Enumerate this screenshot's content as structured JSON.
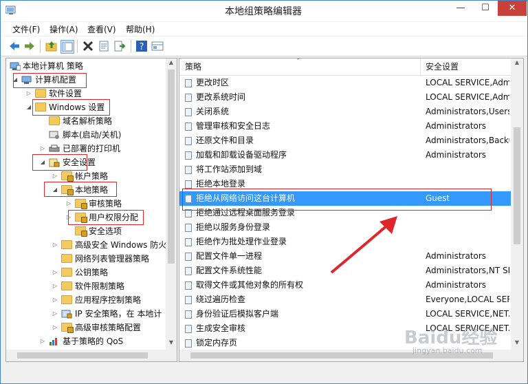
{
  "window": {
    "title": "本地组策略编辑器",
    "min_glyph": "—",
    "max_glyph": "☐",
    "close_glyph": "✕"
  },
  "menu": [
    {
      "label": "文件(F)"
    },
    {
      "label": "操作(A)"
    },
    {
      "label": "查看(V)"
    },
    {
      "label": "帮助(H)"
    }
  ],
  "toolbar": [
    "back-icon",
    "forward-icon",
    "up-folder-icon",
    "show-hide-tree-icon",
    "delete-icon",
    "properties-icon",
    "export-icon",
    "help-icon",
    "filter-icon"
  ],
  "tree": [
    {
      "label": "本地计算机 策略",
      "arrow": "",
      "icon": "computer-policy"
    },
    {
      "label": "计算机配置",
      "arrow": "◢",
      "icon": "computer"
    },
    {
      "label": "软件设置",
      "arrow": "▷",
      "icon": "folder"
    },
    {
      "label": "Windows 设置",
      "arrow": "◢",
      "icon": "folder"
    },
    {
      "label": "域名解析策略",
      "arrow": "",
      "icon": "folder"
    },
    {
      "label": "脚本(启动/关机)",
      "arrow": "",
      "icon": "script"
    },
    {
      "label": "已部署的打印机",
      "arrow": "▷",
      "icon": "printer"
    },
    {
      "label": "安全设置",
      "arrow": "◢",
      "icon": "security"
    },
    {
      "label": "帐户策略",
      "arrow": "▷",
      "icon": "folder-lock"
    },
    {
      "label": "本地策略",
      "arrow": "◢",
      "icon": "folder-lock"
    },
    {
      "label": "审核策略",
      "arrow": "▷",
      "icon": "folder-lock"
    },
    {
      "label": "用户权限分配",
      "arrow": "▷",
      "icon": "folder-lock"
    },
    {
      "label": "安全选项",
      "arrow": "",
      "icon": "folder-lock"
    },
    {
      "label": "高级安全 Windows 防火",
      "arrow": "▷",
      "icon": "folder"
    },
    {
      "label": "网络列表管理器策略",
      "arrow": "",
      "icon": "folder"
    },
    {
      "label": "公钥策略",
      "arrow": "▷",
      "icon": "folder"
    },
    {
      "label": "软件限制策略",
      "arrow": "▷",
      "icon": "folder"
    },
    {
      "label": "应用程序控制策略",
      "arrow": "▷",
      "icon": "folder"
    },
    {
      "label": "IP 安全策略，在 本地计",
      "arrow": "▷",
      "icon": "ip-policy"
    },
    {
      "label": "高级审核策略配置",
      "arrow": "▷",
      "icon": "folder-lock"
    },
    {
      "label": "基于策略的 QoS",
      "arrow": "▷",
      "icon": "qos"
    }
  ],
  "list": {
    "col_policy": "策略",
    "col_setting": "安全设置",
    "sort_glyph": "ˆ",
    "rows": [
      {
        "name": "更改时区",
        "setting": "LOCAL SERVICE,Admi"
      },
      {
        "name": "更改系统时间",
        "setting": "LOCAL SERVICE,Admi"
      },
      {
        "name": "关闭系统",
        "setting": "Administrators,Users,"
      },
      {
        "name": "管理审核和安全日志",
        "setting": "Administrators"
      },
      {
        "name": "还原文件和目录",
        "setting": "Administrators,Backu"
      },
      {
        "name": "加载和卸载设备驱动程序",
        "setting": "Administrators"
      },
      {
        "name": "将工作站添加到域",
        "setting": ""
      },
      {
        "name": "拒绝本地登录",
        "setting": ""
      },
      {
        "name": "拒绝从网络访问这台计算机",
        "setting": "Guest"
      },
      {
        "name": "拒绝通过远程桌面服务登录",
        "setting": ""
      },
      {
        "name": "拒绝以服务身份登录",
        "setting": ""
      },
      {
        "name": "拒绝作为批处理作业登录",
        "setting": ""
      },
      {
        "name": "配置文件单一进程",
        "setting": "Administrators"
      },
      {
        "name": "配置文件系统性能",
        "setting": "Administrators,NT SE"
      },
      {
        "name": "取得文件或其他对象的所有权",
        "setting": "Administrators"
      },
      {
        "name": "绕过遍历检查",
        "setting": "Everyone,LOCAL SERV"
      },
      {
        "name": "身份验证后模拟客户端",
        "setting": "LOCAL SERVICE,NET..."
      },
      {
        "name": "生成安全审核",
        "setting": "LOCAL SERVICE,NET..."
      },
      {
        "name": "锁定内存页",
        "setting": ""
      }
    ]
  },
  "watermark": {
    "brand": "Baidu经验",
    "url": "jingyan.baidu.com"
  },
  "colors": {
    "selection": "#3399ff",
    "annotation": "#e0262b",
    "close_button": "#c7413a"
  }
}
